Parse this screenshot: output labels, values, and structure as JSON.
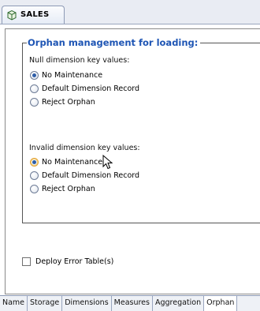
{
  "editor": {
    "tab_title": "SALES",
    "tab_icon": "cube-icon"
  },
  "orphan": {
    "group_title": "Orphan management for loading:",
    "null_section": {
      "label": "Null dimension key values:",
      "options": [
        "No Maintenance",
        "Default Dimension Record",
        "Reject Orphan"
      ],
      "selected": "No Maintenance"
    },
    "invalid_section": {
      "label": "Invalid dimension key values:",
      "options": [
        "No Maintenance",
        "Default Dimension Record",
        "Reject Orphan"
      ],
      "selected": "No Maintenance"
    },
    "deploy_error_tables": {
      "label": "Deploy Error Table(s)",
      "checked": false
    }
  },
  "bottom_tabs": [
    "Name",
    "Storage",
    "Dimensions",
    "Measures",
    "Aggregation",
    "Orphan"
  ],
  "active_bottom_tab": "Orphan",
  "colors": {
    "group_title": "#1e55b4",
    "selected_radio_dot": "#2f5ea8",
    "hover_radio_ring": "#e2a43a"
  }
}
